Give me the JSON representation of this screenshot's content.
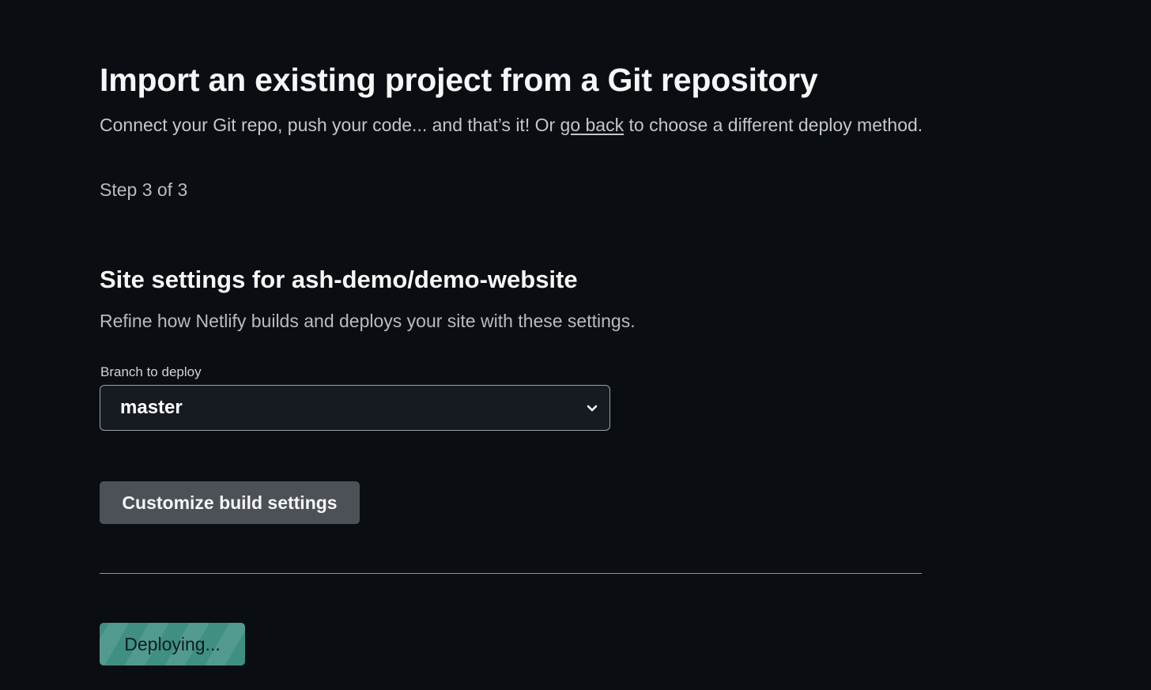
{
  "header": {
    "title": "Import an existing project from a Git repository",
    "intro_before": "Connect your Git repo, push your code... and that’s it! Or ",
    "intro_link": "go back",
    "intro_after": " to choose a different deploy method.",
    "step": "Step 3 of 3"
  },
  "site_settings": {
    "title": "Site settings for ash-demo/demo-website",
    "description": "Refine how Netlify builds and deploys your site with these settings.",
    "branch_label": "Branch to deploy",
    "branch_value": "master",
    "customize_label": "Customize build settings"
  },
  "deploy": {
    "button_label": "Deploying..."
  },
  "colors": {
    "background": "#0a0d11",
    "deploy_button": "#3f8f83",
    "secondary_button": "#4c5157"
  },
  "icons": {
    "select_chevron": "chevron-down-icon"
  }
}
